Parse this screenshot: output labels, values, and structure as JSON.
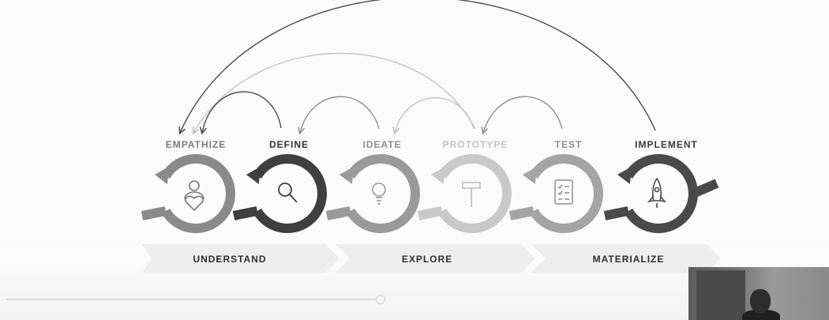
{
  "stages": [
    {
      "label": "EMPATHIZE",
      "icon": "heart-person-icon",
      "color": "#8a8a8a"
    },
    {
      "label": "DEFINE",
      "icon": "magnifier-icon",
      "color": "#3f3f3f"
    },
    {
      "label": "IDEATE",
      "icon": "lightbulb-icon",
      "color": "#9a9a9a"
    },
    {
      "label": "PROTOTYPE",
      "icon": "hammer-icon",
      "color": "#c9c9c9"
    },
    {
      "label": "TEST",
      "icon": "checklist-icon",
      "color": "#a4a4a4"
    },
    {
      "label": "IMPLEMENT",
      "icon": "rocket-icon",
      "color": "#4a4a4a"
    }
  ],
  "phases": [
    {
      "label": "UNDERSTAND"
    },
    {
      "label": "EXPLORE"
    },
    {
      "label": "MATERIALIZE"
    }
  ],
  "colors": {
    "background": "#fbfbfb",
    "arrow_dark": "#4a4a4a",
    "arrow_light": "#bdbdbd",
    "band": "#efefef"
  }
}
